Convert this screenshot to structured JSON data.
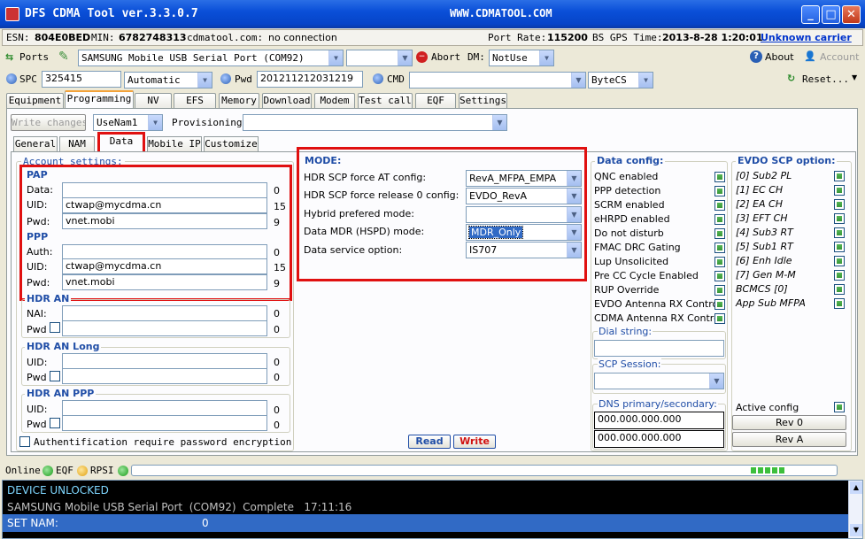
{
  "window": {
    "title": "DFS CDMA Tool ver.3.3.0.7",
    "site": "WWW.CDMATOOL.COM"
  },
  "info": {
    "esn_label": "ESN:",
    "esn": "804E0BED",
    "min_label": "MIN:",
    "min": "6782748313",
    "domain": "cdmatool.com:",
    "conn": "no connection",
    "port_rate_label": "Port Rate:",
    "port_rate": "115200",
    "gps_label": "BS GPS Time:",
    "gps": "2013-8-28 1:20:01",
    "carrier": "Unknown carrier"
  },
  "toolbar1": {
    "ports": "Ports",
    "port_name": "SAMSUNG Mobile USB Serial Port  (COM92)",
    "abort": "Abort",
    "dm_label": "DM:",
    "dm": "NotUse",
    "about": "About",
    "account": "Account"
  },
  "toolbar2": {
    "spc_label": "SPC",
    "spc": "325415",
    "mode": "Automatic",
    "pwd_label": "Pwd",
    "pwd": "201211212031219",
    "cmd_label": "CMD",
    "bytecs": "ByteCS",
    "reset": "Reset..."
  },
  "tabs": [
    "Equipment",
    "Programming",
    "NV",
    "EFS",
    "Memory",
    "Download",
    "Modem",
    "Test call",
    "EQF",
    "Settings"
  ],
  "subbar": {
    "write": "Write changes",
    "nam": "UseNam1",
    "prov": "Provisioning"
  },
  "subtabs": [
    "General",
    "NAM",
    "Data",
    "Mobile IP",
    "Customize"
  ],
  "account": {
    "title": "Account settings:",
    "pap": "PAP",
    "pap_rows": [
      {
        "l": "Data:",
        "v": "",
        "n": "0"
      },
      {
        "l": "UID:",
        "v": "ctwap@mycdma.cn",
        "n": "15"
      },
      {
        "l": "Pwd:",
        "v": "vnet.mobi",
        "n": "9"
      }
    ],
    "ppp": "PPP",
    "ppp_rows": [
      {
        "l": "Auth:",
        "v": "",
        "n": "0"
      },
      {
        "l": "UID:",
        "v": "ctwap@mycdma.cn",
        "n": "15"
      },
      {
        "l": "Pwd:",
        "v": "vnet.mobi",
        "n": "9"
      }
    ],
    "hdr": "HDR AN",
    "hdr_rows": [
      {
        "l": "NAI:",
        "v": "",
        "n": "0"
      },
      {
        "l": "Pwd",
        "v": "",
        "n": "0"
      }
    ],
    "hdrl": "HDR AN Long",
    "hdrl_rows": [
      {
        "l": "UID:",
        "v": "",
        "n": "0"
      },
      {
        "l": "Pwd",
        "v": "",
        "n": "0"
      }
    ],
    "hdrp": "HDR AN PPP",
    "hdrp_rows": [
      {
        "l": "UID:",
        "v": "",
        "n": "0"
      },
      {
        "l": "Pwd",
        "v": "",
        "n": "0"
      }
    ],
    "auth_req": "Authentification require password encryption"
  },
  "mode": {
    "title": "MODE:",
    "rows": [
      {
        "l": "HDR SCP force AT config:",
        "v": "RevA_MFPA_EMPA"
      },
      {
        "l": "HDR SCP force release 0 config:",
        "v": "EVDO_RevA"
      },
      {
        "l": "Hybrid prefered mode:",
        "v": ""
      },
      {
        "l": "Data MDR (HSPD) mode:",
        "v": "MDR_Only"
      },
      {
        "l": "Data service option:",
        "v": "IS707"
      }
    ],
    "read": "Read",
    "write": "Write"
  },
  "dataconfig": {
    "title": "Data config:",
    "items": [
      "QNC enabled",
      "PPP detection",
      "SCRM enabled",
      "eHRPD enabled",
      "Do not disturb",
      "FMAC DRC Gating",
      "Lup Unsolicited",
      "Pre CC Cycle Enabled",
      "RUP Override",
      "EVDO Antenna RX Control",
      "CDMA Antenna RX Control"
    ],
    "dial": "Dial string:",
    "scp": "SCP Session:",
    "dns": "DNS primary/secondary:",
    "dns1": "000.000.000.000",
    "dns2": "000.000.000.000"
  },
  "evdo": {
    "title": "EVDO SCP option:",
    "items": [
      "[0] Sub2 PL",
      "[1] EC CH",
      "[2] EA CH",
      "[3] EFT CH",
      "[4] Sub3 RT",
      "[5] Sub1 RT",
      "[6] Enh Idle",
      "[7] Gen M-M",
      "BCMCS [0]",
      "App Sub MFPA"
    ],
    "active": "Active config",
    "rev0": "Rev 0",
    "reva": "Rev A"
  },
  "status": {
    "online": "Online",
    "eqf": "EQF",
    "rpsi": "RPSI"
  },
  "log": {
    "l1": "DEVICE UNLOCKED",
    "l2": "SAMSUNG Mobile USB Serial Port  (COM92)  Complete   17:11:16",
    "l3a": "SET NAM:",
    "l3b": "0"
  },
  "colors": {
    "title_blue": "#0a4fd8",
    "legend_blue": "#1f4da6",
    "red": "#e01010",
    "log_bg": "#000000",
    "log_sel": "#316ac5"
  }
}
